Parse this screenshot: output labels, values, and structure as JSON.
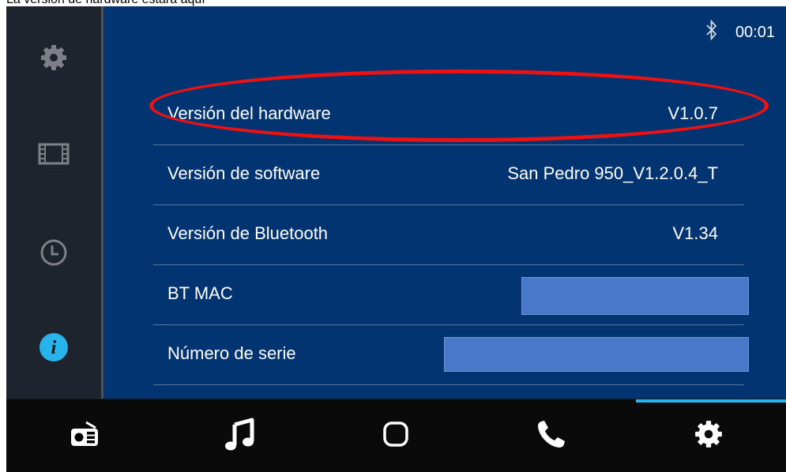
{
  "caption": "La versión de hardware estará aquí",
  "status": {
    "bluetooth_icon": "bluetooth-icon",
    "time": "00:01"
  },
  "sidebar": {
    "items": [
      {
        "icon": "gear-icon",
        "active": false
      },
      {
        "icon": "film-icon",
        "active": false
      },
      {
        "icon": "clock-icon",
        "active": false
      },
      {
        "icon": "info-icon",
        "active": true
      }
    ]
  },
  "info_rows": [
    {
      "label": "Versión del hardware",
      "value": "V1.0.7"
    },
    {
      "label": "Versión de software",
      "value": "San Pedro 950_V1.2.0.4_T"
    },
    {
      "label": "Versión de Bluetooth",
      "value": "V1.34"
    },
    {
      "label": "BT MAC",
      "value": ""
    },
    {
      "label": "Número de serie",
      "value": ""
    }
  ],
  "bottom_nav": {
    "items": [
      {
        "icon": "radio-icon"
      },
      {
        "icon": "music-icon"
      },
      {
        "icon": "home-icon"
      },
      {
        "icon": "phone-icon"
      },
      {
        "icon": "settings-icon",
        "active": true
      }
    ]
  },
  "colors": {
    "panel": "#023472",
    "sidebar": "#1e242e",
    "accent": "#28b4ea",
    "highlight": "#ee1111",
    "redaction": "#4a78c8"
  }
}
